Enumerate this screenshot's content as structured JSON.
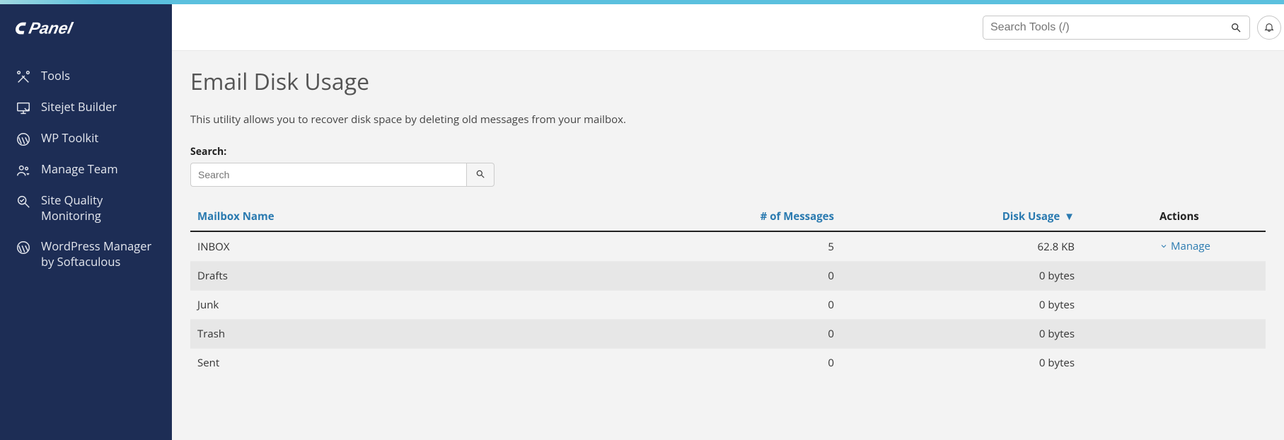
{
  "brand": "cPanel",
  "sidebar": {
    "items": [
      {
        "label": "Tools",
        "icon": "tools-icon"
      },
      {
        "label": "Sitejet Builder",
        "icon": "monitor-icon"
      },
      {
        "label": "WP Toolkit",
        "icon": "wordpress-icon"
      },
      {
        "label": "Manage Team",
        "icon": "team-icon"
      },
      {
        "label": "Site Quality Monitoring",
        "icon": "quality-icon"
      },
      {
        "label": "WordPress Manager by Softaculous",
        "icon": "wordpress-icon"
      }
    ]
  },
  "header": {
    "search_placeholder": "Search Tools (/)"
  },
  "page": {
    "title": "Email Disk Usage",
    "description": "This utility allows you to recover disk space by deleting old messages from your mailbox.",
    "search_label": "Search:",
    "search_placeholder": "Search"
  },
  "table": {
    "columns": {
      "name": "Mailbox Name",
      "messages": "# of Messages",
      "disk": "Disk Usage",
      "actions": "Actions"
    },
    "sort_indicator": "▼",
    "manage_label": "Manage",
    "rows": [
      {
        "name": "INBOX",
        "messages": "5",
        "disk": "62.8 KB",
        "managed": true
      },
      {
        "name": "Drafts",
        "messages": "0",
        "disk": "0 bytes",
        "managed": false
      },
      {
        "name": "Junk",
        "messages": "0",
        "disk": "0 bytes",
        "managed": false
      },
      {
        "name": "Trash",
        "messages": "0",
        "disk": "0 bytes",
        "managed": false
      },
      {
        "name": "Sent",
        "messages": "0",
        "disk": "0 bytes",
        "managed": false
      }
    ]
  }
}
